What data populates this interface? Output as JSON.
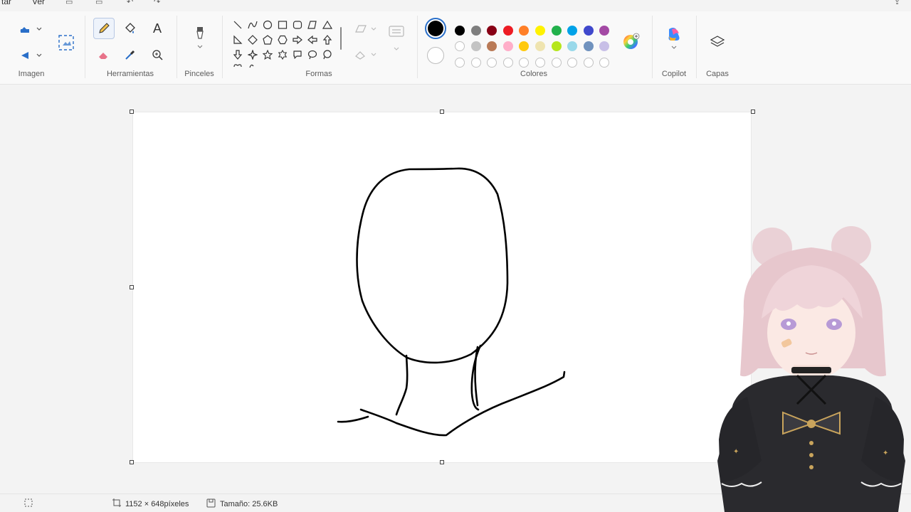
{
  "menu": {
    "file_label": "tar",
    "view_label": "Ver"
  },
  "ribbon": {
    "groups": {
      "image": "Imagen",
      "tools": "Herramientas",
      "brushes": "Pinceles",
      "shapes": "Formas",
      "colors": "Colores",
      "copilot": "Copilot",
      "layers": "Capas"
    },
    "text_tool_glyph": "A"
  },
  "colors": {
    "primary": "#000000",
    "secondary": "#ffffff",
    "palette_row1": [
      "#000000",
      "#7f7f7f",
      "#880015",
      "#ed1c24",
      "#ff7f27",
      "#fff200",
      "#22b14c",
      "#00a2e8",
      "#3f48cc",
      "#a349a4"
    ],
    "palette_row2": [
      "#ffffff",
      "#c3c3c3",
      "#b97a57",
      "#ffaec9",
      "#ffc90e",
      "#efe4b0",
      "#b5e61d",
      "#99d9ea",
      "#7092be",
      "#c8bfe7"
    ],
    "palette_row3_empty_count": 10
  },
  "statusbar": {
    "dimensions": "1152 × 648píxeles",
    "size": "Tamaño: 25.6KB"
  }
}
